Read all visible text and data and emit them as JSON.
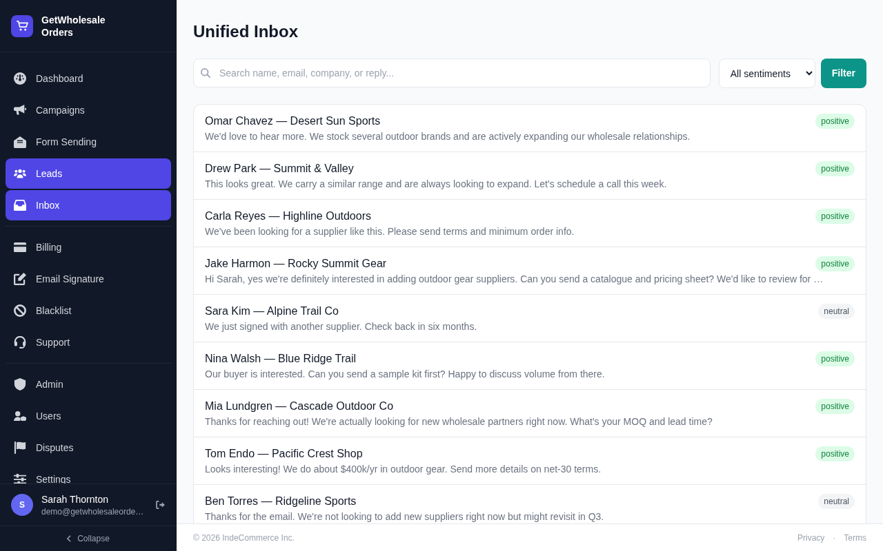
{
  "sidebar": {
    "brand": "GetWholesale Orders",
    "nav_groups": [
      {
        "items": [
          {
            "label": "Dashboard",
            "selected": false
          },
          {
            "label": "Campaigns",
            "selected": false
          },
          {
            "label": "Form Sending",
            "selected": false
          },
          {
            "label": "Leads",
            "selected": true
          },
          {
            "label": "Inbox",
            "selected": true
          }
        ]
      },
      {
        "items": [
          {
            "label": "Billing",
            "selected": false
          },
          {
            "label": "Email Signature",
            "selected": false
          },
          {
            "label": "Blacklist",
            "selected": false
          },
          {
            "label": "Support",
            "selected": false
          }
        ]
      },
      {
        "items": [
          {
            "label": "Admin",
            "selected": false
          },
          {
            "label": "Users",
            "selected": false
          },
          {
            "label": "Disputes",
            "selected": false
          },
          {
            "label": "Settings",
            "selected": false
          }
        ]
      }
    ],
    "user": {
      "initial": "S",
      "name": "Sarah Thornton",
      "email": "demo@getwholesaleorde…"
    },
    "collapse_label": "Collapse"
  },
  "main": {
    "title": "Unified Inbox",
    "search": {
      "placeholder": "Search name, email, company, or reply..."
    },
    "sentiment_filter": {
      "value": "All sentiments"
    },
    "filter_button": "Filter",
    "messages": [
      {
        "sender": "Omar Chavez — Desert Sun Sports",
        "preview": "We'd love to hear more. We stock several outdoor brands and are actively expanding our wholesale relationships.",
        "badge": "positive",
        "kind": "positive"
      },
      {
        "sender": "Drew Park — Summit & Valley",
        "preview": "This looks great. We carry a similar range and are always looking to expand. Let's schedule a call this week.",
        "badge": "positive",
        "kind": "positive"
      },
      {
        "sender": "Carla Reyes — Highline Outdoors",
        "preview": "We've been looking for a supplier like this. Please send terms and minimum order info.",
        "badge": "positive",
        "kind": "positive"
      },
      {
        "sender": "Jake Harmon — Rocky Summit Gear",
        "preview": "Hi Sarah, yes we're definitely interested in adding outdoor gear suppliers. Can you send a catalogue and pricing sheet? We'd like to review for …",
        "badge": "positive",
        "kind": "positive"
      },
      {
        "sender": "Sara Kim — Alpine Trail Co",
        "preview": "We just signed with another supplier. Check back in six months.",
        "badge": "neutral",
        "kind": "neutral"
      },
      {
        "sender": "Nina Walsh — Blue Ridge Trail",
        "preview": "Our buyer is interested. Can you send a sample kit first? Happy to discuss volume from there.",
        "badge": "positive",
        "kind": "positive"
      },
      {
        "sender": "Mia Lundgren — Cascade Outdoor Co",
        "preview": "Thanks for reaching out! We're actually looking for new wholesale partners right now. What's your MOQ and lead time?",
        "badge": "positive",
        "kind": "positive"
      },
      {
        "sender": "Tom Endo — Pacific Crest Shop",
        "preview": "Looks interesting! We do about $400k/yr in outdoor gear. Send more details on net-30 terms.",
        "badge": "positive",
        "kind": "positive"
      },
      {
        "sender": "Ben Torres — Ridgeline Sports",
        "preview": "Thanks for the email. We're not looking to add new suppliers right now but might revisit in Q3.",
        "badge": "neutral",
        "kind": "neutral"
      }
    ]
  },
  "footer": {
    "copyright": "© 2026 IndeCommerce Inc.",
    "links": [
      "Privacy",
      "Terms"
    ],
    "separator": "·"
  }
}
